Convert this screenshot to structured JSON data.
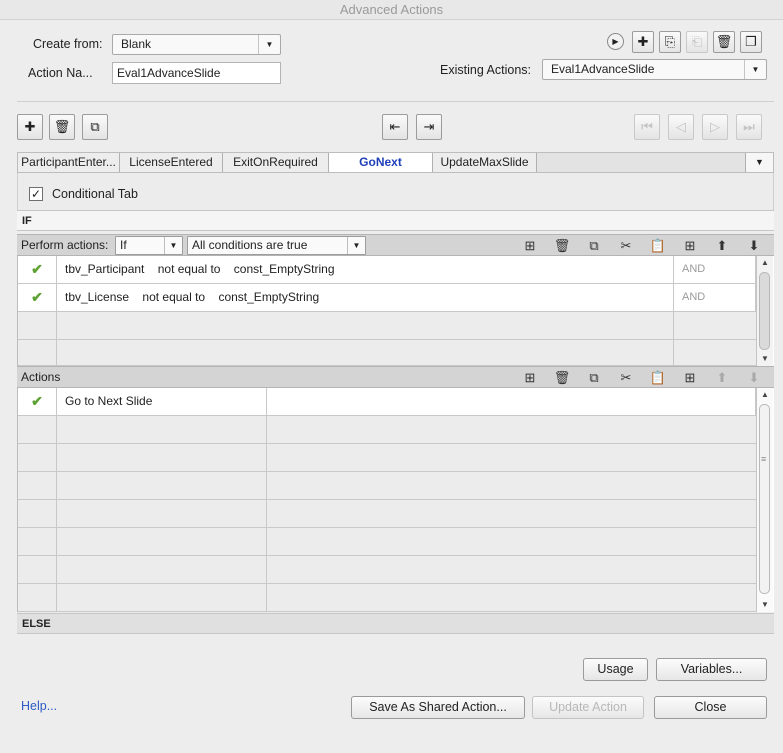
{
  "window": {
    "title": "Advanced Actions"
  },
  "header": {
    "create_from_label": "Create from:",
    "create_from_value": "Blank",
    "action_name_label": "Action Na...",
    "action_name_value": "Eval1AdvanceSlide",
    "existing_actions_label": "Existing Actions:",
    "existing_actions_value": "Eval1AdvanceSlide"
  },
  "top_toolbar": {
    "icons": [
      "play-icon",
      "add-icon",
      "import-icon",
      "export-icon",
      "delete-icon",
      "duplicate-icon"
    ]
  },
  "tab_toolbar": {
    "left_icons": [
      "add-icon",
      "trash-icon",
      "duplicate-icon"
    ],
    "mid_icons": [
      "move-left-icon",
      "move-right-icon"
    ],
    "nav_icons": [
      "first-icon",
      "previous-icon",
      "next-icon",
      "last-icon"
    ]
  },
  "tabs": [
    {
      "label": "ParticipantEnter...",
      "active": false
    },
    {
      "label": "LicenseEntered",
      "active": false
    },
    {
      "label": "ExitOnRequired",
      "active": false
    },
    {
      "label": "GoNext",
      "active": true
    },
    {
      "label": "UpdateMaxSlide",
      "active": false
    }
  ],
  "conditional": {
    "label": "Conditional Tab",
    "checked": "✓"
  },
  "if_section": {
    "label": "IF"
  },
  "perform_bar": {
    "label": "Perform actions:",
    "mode_value": "If",
    "condition_value": "All conditions are true"
  },
  "conditions": [
    {
      "var": "tbv_Participant",
      "op": "not equal to",
      "value": "const_EmptyString",
      "logic": "AND"
    },
    {
      "var": "tbv_License",
      "op": "not equal to",
      "value": "const_EmptyString",
      "logic": "AND"
    }
  ],
  "actions_bar": {
    "label": "Actions"
  },
  "actions": [
    {
      "action": "Go to Next Slide"
    }
  ],
  "else_section": {
    "label": "ELSE"
  },
  "buttons": {
    "usage": "Usage",
    "variables": "Variables...",
    "help": "Help...",
    "save_shared": "Save As Shared Action...",
    "update_action": "Update Action",
    "close": "Close"
  },
  "colors": {
    "accent_tab": "#1f3fb8",
    "check": "#5ea233",
    "link": "#2c5cc4"
  }
}
